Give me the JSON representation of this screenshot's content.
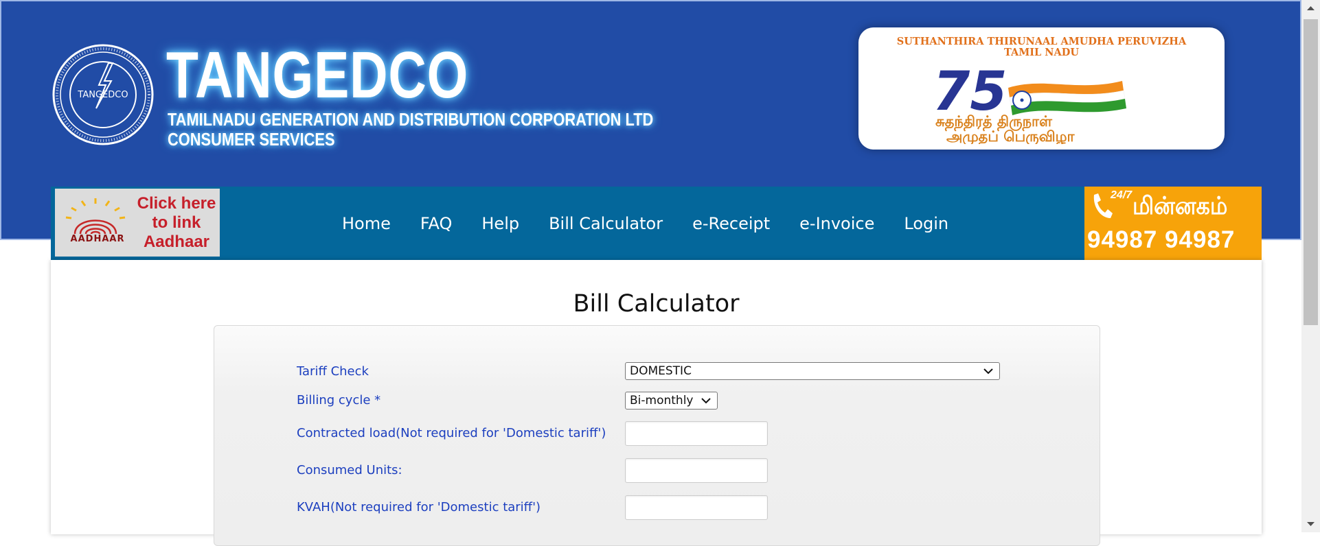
{
  "header": {
    "seal_text": "TANGEDCO",
    "title": "TANGEDCO",
    "subtitle": "TAMILNADU GENERATION AND DISTRIBUTION CORPORATION LTD",
    "service": "CONSUMER SERVICES",
    "event_line_1": "SUTHANTHIRA THIRUNAAL  AMUDHA PERUVIZHA",
    "event_line_2": "TAMIL NADU",
    "event_logo_text_1": "சுதந்திரத் திருநாள்",
    "event_logo_text_2": "அமுதப் பெருவிழா"
  },
  "aadhaar": {
    "word": "AADHAAR",
    "cta": "Click here to link Aadhaar"
  },
  "nav": {
    "items": [
      "Home",
      "FAQ",
      "Help",
      "Bill Calculator",
      "e-Receipt",
      "e-Invoice",
      "Login"
    ]
  },
  "helpline": {
    "badge": "24/7",
    "title": "மின்னகம்",
    "number": "94987 94987",
    "color": "#f7a30a"
  },
  "page": {
    "heading": "Bill Calculator"
  },
  "form": {
    "tariff_label": "Tariff Check",
    "tariff_value": "DOMESTIC",
    "billing_label": "Billing cycle *",
    "billing_value": "Bi-monthly",
    "contracted_label": "Contracted load(Not required for 'Domestic tariff')",
    "contracted_value": "",
    "consumed_label": "Consumed Units:",
    "consumed_value": "",
    "kvah_label": "KVAH(Not required for 'Domestic tariff')",
    "kvah_value": "",
    "label_color": "#1c3fbf"
  },
  "colors": {
    "banner": "#214ca6",
    "nav": "#04679b"
  }
}
